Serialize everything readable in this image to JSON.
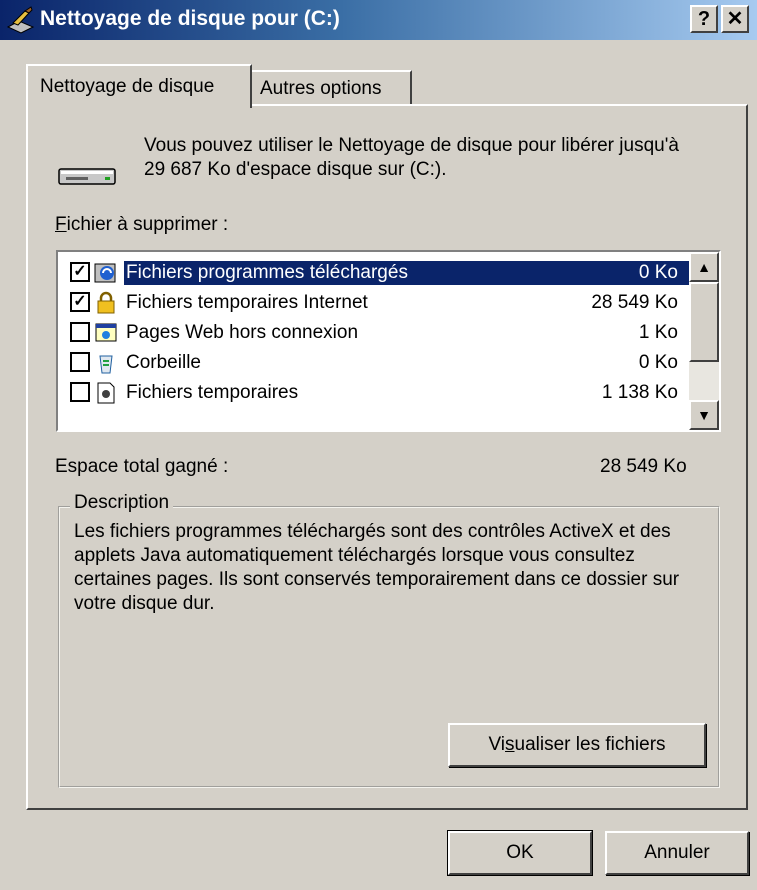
{
  "window": {
    "title": "Nettoyage de disque pour  (C:)",
    "help_label": "?",
    "close_label": "✕"
  },
  "tabs": [
    {
      "label": "Nettoyage de disque",
      "active": true
    },
    {
      "label": "Autres options",
      "active": false
    }
  ],
  "intro": "Vous pouvez utiliser le Nettoyage de disque pour libérer jusqu'à 29 687 Ko d'espace disque sur  (C:).",
  "files_label": {
    "accel": "F",
    "rest": "ichier à supprimer :"
  },
  "files": [
    {
      "name": "Fichiers programmes téléchargés",
      "size": "0 Ko",
      "checked": true,
      "selected": true,
      "icon": "activex-icon"
    },
    {
      "name": "Fichiers temporaires Internet",
      "size": "28 549 Ko",
      "checked": true,
      "selected": false,
      "icon": "lock-icon"
    },
    {
      "name": "Pages Web hors connexion",
      "size": "1 Ko",
      "checked": false,
      "selected": false,
      "icon": "offline-pages-icon"
    },
    {
      "name": "Corbeille",
      "size": "0 Ko",
      "checked": false,
      "selected": false,
      "icon": "recycle-bin-icon"
    },
    {
      "name": "Fichiers temporaires",
      "size": "1 138 Ko",
      "checked": false,
      "selected": false,
      "icon": "temp-files-icon"
    }
  ],
  "scroll": {
    "up": "▲",
    "down": "▼"
  },
  "gain": {
    "label": "Espace total gagné :",
    "value": "28 549 Ko"
  },
  "description": {
    "legend": "Description",
    "text": "Les fichiers programmes téléchargés sont des contrôles ActiveX et des applets Java automatiquement téléchargés lorsque vous consultez certaines pages. Ils sont conservés temporairement dans ce dossier sur votre disque dur."
  },
  "buttons": {
    "view_pre": "Vi",
    "view_accel": "s",
    "view_post": "ualiser les fichiers",
    "ok": "OK",
    "cancel": "Annuler"
  },
  "colors": {
    "title_start": "#0a246a",
    "title_end": "#a6caf0",
    "face": "#d4d0c8",
    "selection": "#0a246a"
  }
}
